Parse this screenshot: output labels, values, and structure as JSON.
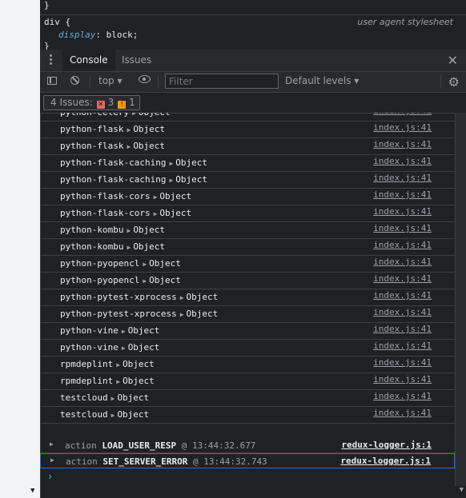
{
  "styles_pane": {
    "line1": "}",
    "selector": "div {",
    "origin": "user agent stylesheet",
    "prop_name": "display",
    "prop_value": ": block;",
    "close": "}"
  },
  "tabs": [
    {
      "label": "Console",
      "active": true
    },
    {
      "label": "Issues",
      "active": false
    }
  ],
  "toolbar": {
    "context": "top",
    "filter_placeholder": "Filter",
    "levels": "Default levels"
  },
  "issues": {
    "label": "4 Issues:",
    "errors": "3",
    "warnings": "1"
  },
  "logs": [
    {
      "name": "python-celery",
      "obj": "Object",
      "src": "index.js:41"
    },
    {
      "name": "python-flask",
      "obj": "Object",
      "src": "index.js:41"
    },
    {
      "name": "python-flask",
      "obj": "Object",
      "src": "index.js:41"
    },
    {
      "name": "python-flask-caching",
      "obj": "Object",
      "src": "index.js:41"
    },
    {
      "name": "python-flask-caching",
      "obj": "Object",
      "src": "index.js:41"
    },
    {
      "name": "python-flask-cors",
      "obj": "Object",
      "src": "index.js:41"
    },
    {
      "name": "python-flask-cors",
      "obj": "Object",
      "src": "index.js:41"
    },
    {
      "name": "python-kombu",
      "obj": "Object",
      "src": "index.js:41"
    },
    {
      "name": "python-kombu",
      "obj": "Object",
      "src": "index.js:41"
    },
    {
      "name": "python-pyopencl",
      "obj": "Object",
      "src": "index.js:41"
    },
    {
      "name": "python-pyopencl",
      "obj": "Object",
      "src": "index.js:41"
    },
    {
      "name": "python-pytest-xprocess",
      "obj": "Object",
      "src": "index.js:41"
    },
    {
      "name": "python-pytest-xprocess",
      "obj": "Object",
      "src": "index.js:41"
    },
    {
      "name": "python-vine",
      "obj": "Object",
      "src": "index.js:41"
    },
    {
      "name": "python-vine",
      "obj": "Object",
      "src": "index.js:41"
    },
    {
      "name": "rpmdeplint",
      "obj": "Object",
      "src": "index.js:41"
    },
    {
      "name": "rpmdeplint",
      "obj": "Object",
      "src": "index.js:41"
    },
    {
      "name": "testcloud",
      "obj": "Object",
      "src": "index.js:41"
    },
    {
      "name": "testcloud",
      "obj": "Object",
      "src": "index.js:41"
    }
  ],
  "actions": [
    {
      "prefix": "action",
      "type": "LOAD_USER_RESP",
      "time": "@ 13:44:32.677",
      "src": "redux-logger.js:1",
      "selected": false
    },
    {
      "prefix": "action",
      "type": "SET_SERVER_ERROR",
      "time": "@ 13:44:32.743",
      "src": "redux-logger.js:1",
      "selected": true
    }
  ],
  "prompt": "›",
  "icons": [
    "sidebar-toggle-icon",
    "clear-console-icon",
    "eye-icon",
    "gear-icon",
    "close-icon",
    "kebab-menu-icon",
    "error-icon",
    "warning-icon"
  ],
  "colors": {
    "accent": "#1a73e8",
    "error": "#e46962",
    "warning": "#f29900",
    "prompt": "#4db6ff"
  }
}
